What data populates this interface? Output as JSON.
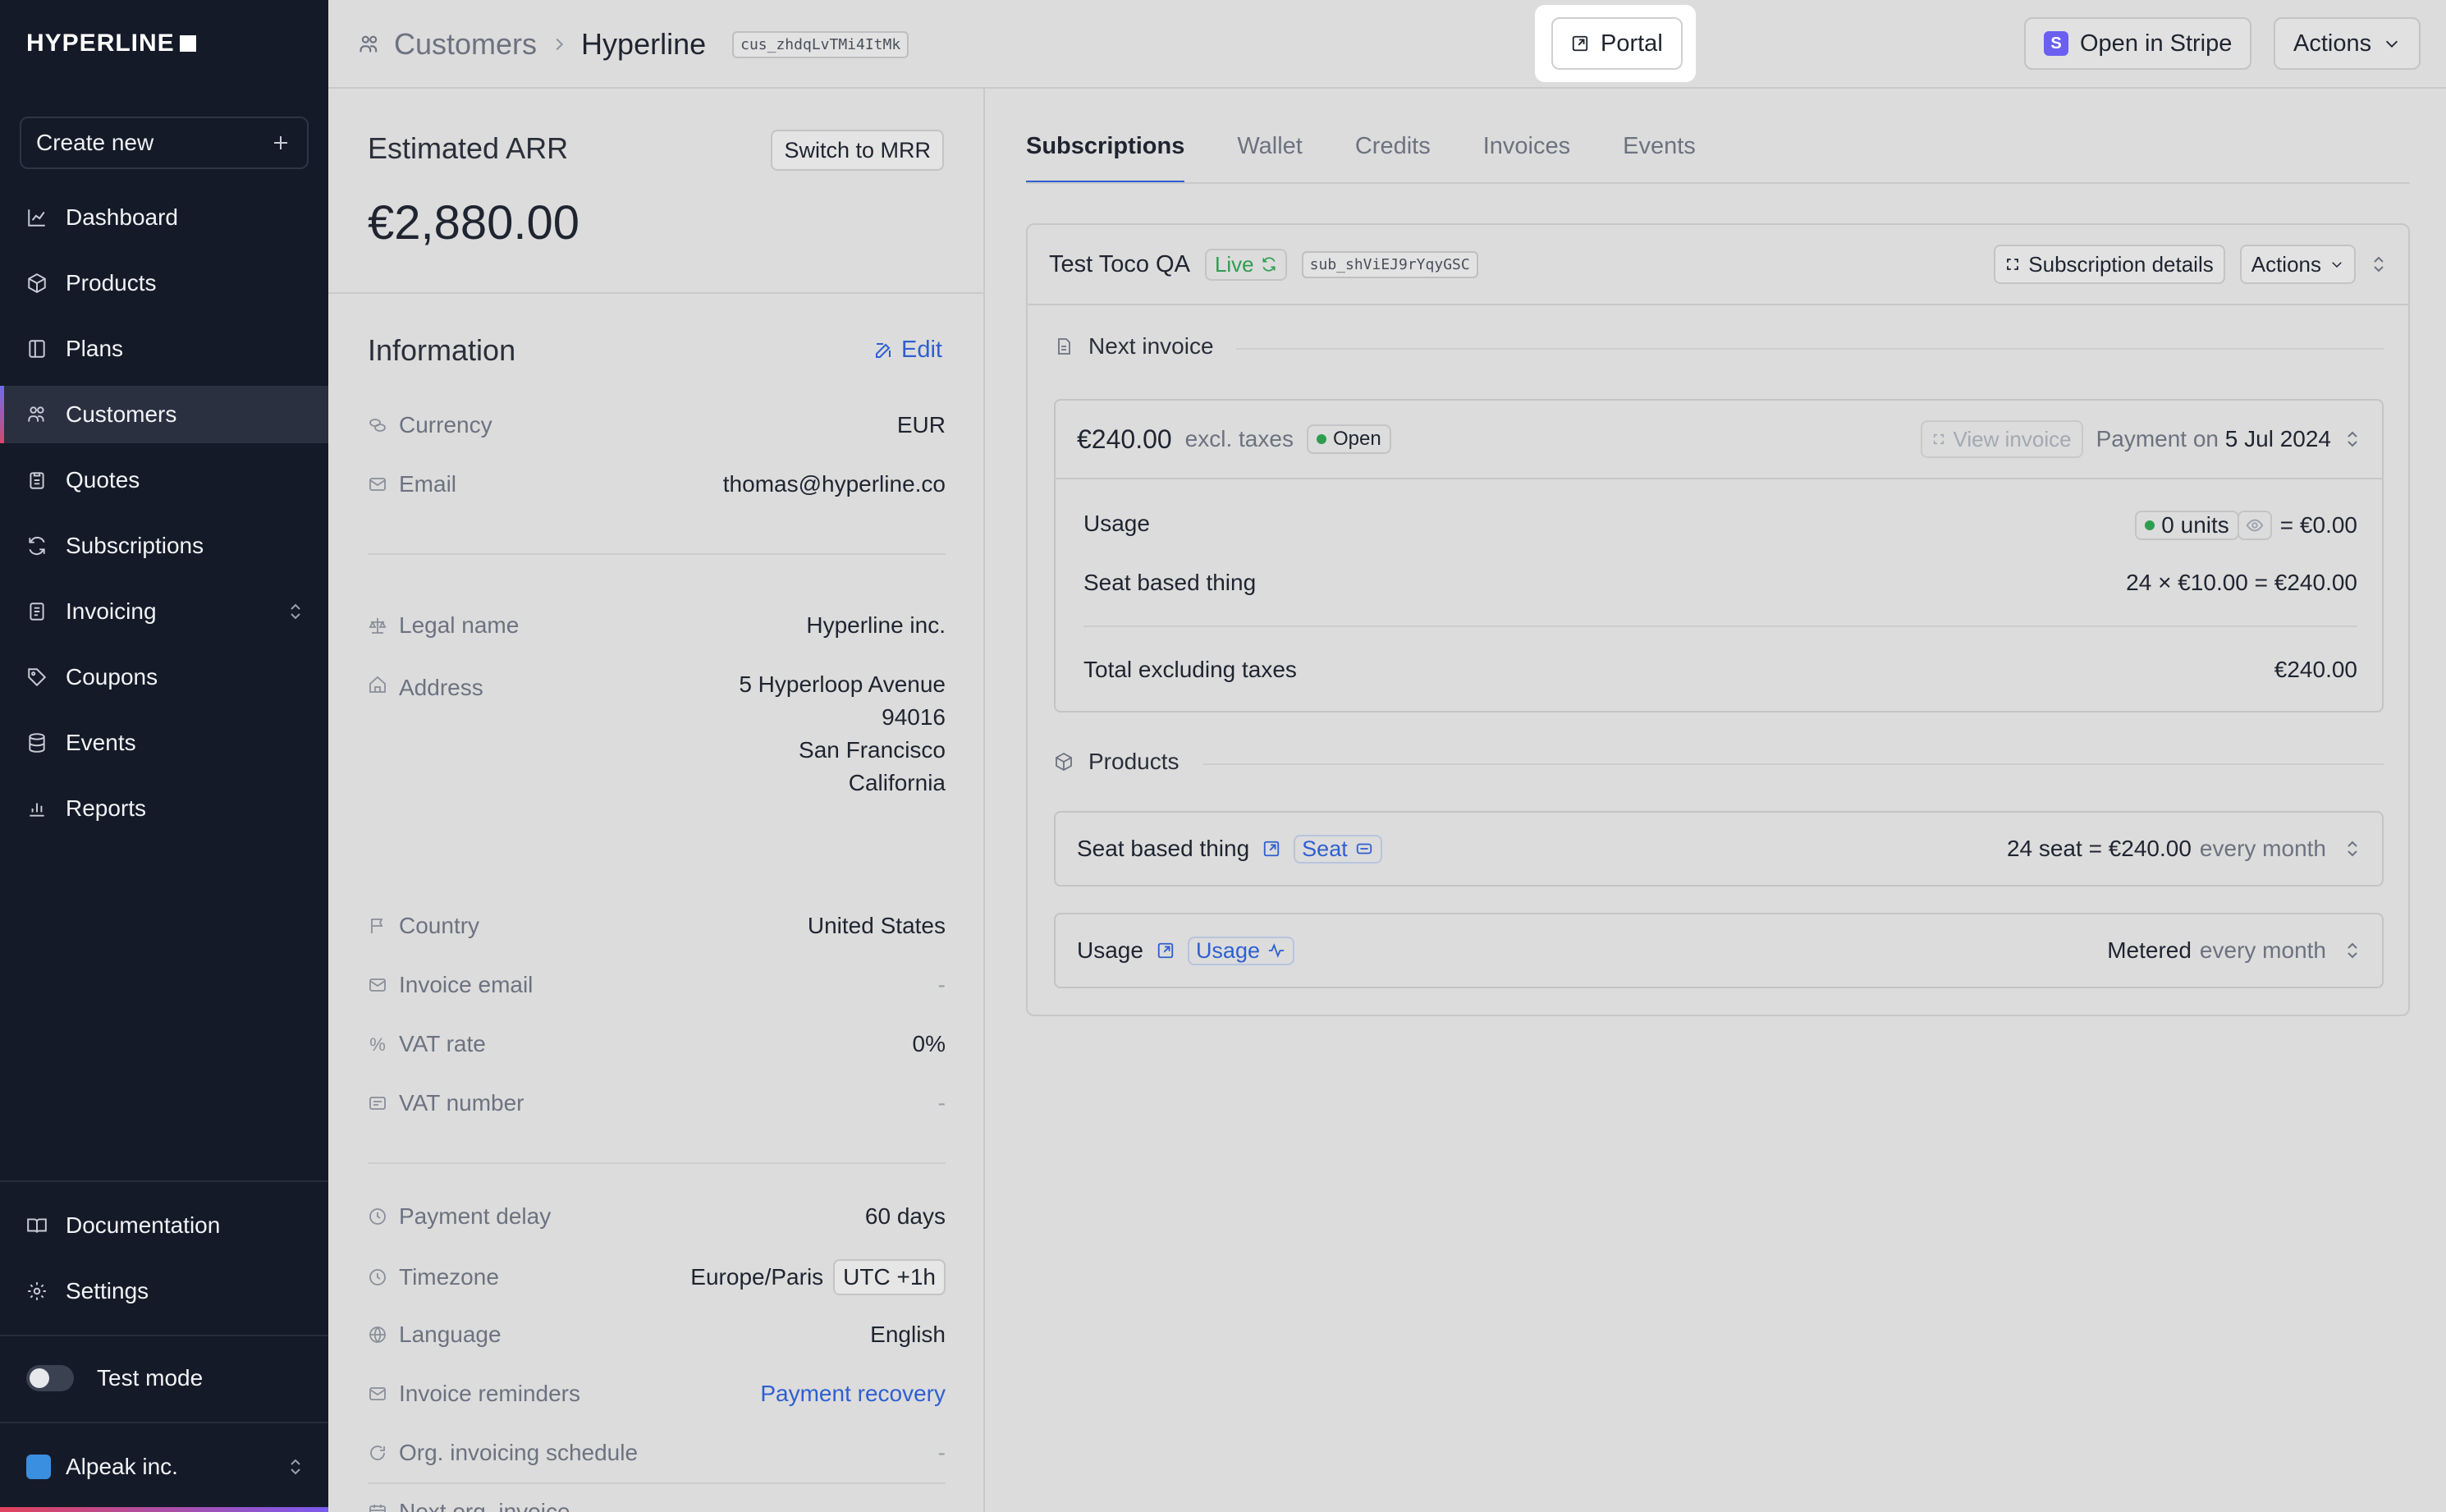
{
  "sidebar": {
    "logo": "HYPERLINE",
    "create_new": "Create new",
    "items": [
      {
        "label": "Dashboard"
      },
      {
        "label": "Products"
      },
      {
        "label": "Plans"
      },
      {
        "label": "Customers"
      },
      {
        "label": "Quotes"
      },
      {
        "label": "Subscriptions"
      },
      {
        "label": "Invoicing"
      },
      {
        "label": "Coupons"
      },
      {
        "label": "Events"
      },
      {
        "label": "Reports"
      }
    ],
    "bottom": [
      {
        "label": "Documentation"
      },
      {
        "label": "Settings"
      }
    ],
    "test_mode": "Test mode",
    "org": "Alpeak inc."
  },
  "header": {
    "breadcrumb_parent": "Customers",
    "breadcrumb_current": "Hyperline",
    "customer_id": "cus_zhdqLvTMi4ItMk",
    "portal": "Portal",
    "open_in_stripe": "Open in Stripe",
    "stripe_letter": "S",
    "actions": "Actions"
  },
  "arr": {
    "title": "Estimated ARR",
    "switch": "Switch to MRR",
    "value": "€2,880.00"
  },
  "info": {
    "title": "Information",
    "edit": "Edit",
    "currency_label": "Currency",
    "currency": "EUR",
    "email_label": "Email",
    "email": "thomas@hyperline.co",
    "legal_label": "Legal name",
    "legal": "Hyperline inc.",
    "address_label": "Address",
    "address_1": "5 Hyperloop Avenue",
    "address_2": "94016",
    "address_3": "San Francisco",
    "address_4": "California",
    "country_label": "Country",
    "country": "United States",
    "invoice_email_label": "Invoice email",
    "invoice_email": "-",
    "vat_rate_label": "VAT rate",
    "vat_rate": "0%",
    "vat_number_label": "VAT number",
    "vat_number": "-",
    "payment_delay_label": "Payment delay",
    "payment_delay": "60 days",
    "timezone_label": "Timezone",
    "timezone": "Europe/Paris",
    "utc": "UTC +1h",
    "language_label": "Language",
    "language": "English",
    "reminders_label": "Invoice reminders",
    "reminders": "Payment recovery",
    "org_schedule_label": "Org. invoicing schedule",
    "org_schedule": "-",
    "next_org_label": "Next org. invoice",
    "next_org": "-"
  },
  "tabs": [
    "Subscriptions",
    "Wallet",
    "Credits",
    "Invoices",
    "Events"
  ],
  "subscription": {
    "name": "Test Toco QA",
    "status": "Live",
    "id": "sub_shViEJ9rYqyGSC",
    "details": "Subscription details",
    "actions": "Actions",
    "next_invoice_label": "Next invoice",
    "invoice": {
      "amount": "€240.00",
      "excl": "excl. taxes",
      "status": "Open",
      "view": "View invoice",
      "payment_prefix": "Payment on",
      "payment_date": "5 Jul 2024",
      "usage_label": "Usage",
      "usage_units": "0 units",
      "usage_total": "= €0.00",
      "seat_label": "Seat based thing",
      "seat_calc": "24 × €10.00 = €240.00",
      "total_label": "Total excluding taxes",
      "total": "€240.00"
    },
    "products_label": "Products",
    "products": [
      {
        "name": "Seat based thing",
        "tag": "Seat",
        "price": "24 seat = €240.00",
        "period": "every month"
      },
      {
        "name": "Usage",
        "tag": "Usage",
        "price": "Metered",
        "period": "every month"
      }
    ]
  },
  "colors": {
    "accent": "#2f5fd0",
    "live": "#2e9d4f",
    "sidebar": "#141a27"
  }
}
